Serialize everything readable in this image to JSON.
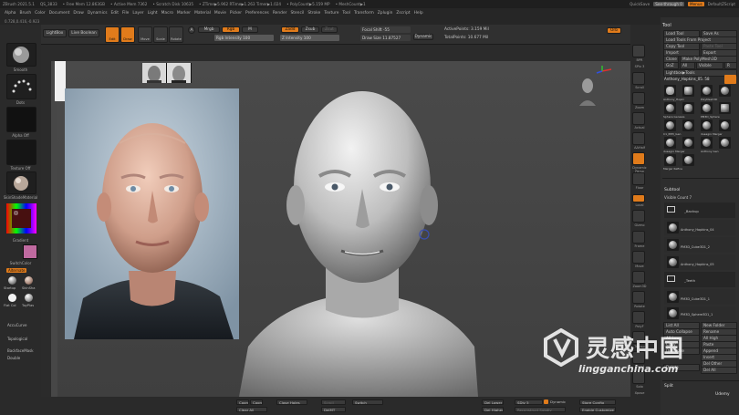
{
  "titlebar": {
    "app": "ZBrush 2021.5.1",
    "project": "QS_3833",
    "free_mem": "• Free Mem 12.863GB",
    "active_mem": "• Active Mem 7362",
    "scratch_disk": "• Scratch Disk 10635",
    "ztime": "• ZTime▶5.962 RTime▶1.263 Timer▶1.024",
    "polycount": "• PolyCount▶5.159 MP",
    "meshcount": "• MeshCount▶1",
    "quicksave": "QuickSave",
    "see_through": "See-through 0",
    "menus": "Menus",
    "default_script": "DefaultZScript"
  },
  "menubar": [
    "Alpha",
    "Brush",
    "Color",
    "Document",
    "Draw",
    "Dynamics",
    "Edit",
    "File",
    "Layer",
    "Light",
    "Macro",
    "Marker",
    "Material",
    "Movie",
    "Picker",
    "Preferences",
    "Render",
    "Stencil",
    "Stroke",
    "Texture",
    "Tool",
    "Transform",
    "Zplugin",
    "Zscript",
    "Help"
  ],
  "topstrip": "0.728,0.416,-0.923",
  "toolbar": {
    "lightbox": "LightBox",
    "live_boolean": "Live Boolean",
    "edit": "Edit",
    "draw": "Draw",
    "move": "Move",
    "scale": "Scale",
    "rotate": "Rotate",
    "a_label": "A",
    "mrgb": "Mrgb",
    "rgb": "Rgb",
    "m": "M",
    "zadd": "Zadd",
    "zsub": "Zsub",
    "zcut": "Zcut",
    "rgb_intensity": "Rgb Intensity 100",
    "z_intensity": "Z Intensity 100",
    "focal_shift": "Focal Shift -55",
    "draw_size": "Draw Size 11.87527",
    "dynamic": "Dynamic",
    "active_points": "ActivePoints: 3.159 Mil",
    "total_points": "TotalPoints: 10.677 Mil",
    "orb": "Orb"
  },
  "leftshelf": {
    "brush": "Smooth",
    "stroke": "Dots",
    "alpha": "Alpha Off",
    "texture": "Texture Off",
    "material": "SkinShadeMaterial",
    "gradient": "Gradient",
    "switch_color": "SwitchColor",
    "alternate": "Alternate",
    "startup_1": "Startup",
    "startup_2": "SkinSha",
    "flat_color": "Flat Col",
    "toy_plastic": "ToyPlas",
    "accucurve": "AccuCurve",
    "topological": "Topological",
    "backface_mask": "BackfaceMask",
    "double": "Double"
  },
  "rightshelf": [
    "BPR",
    "SPix 3",
    "Scroll",
    "Zoom",
    "Actual",
    "AAHalf",
    "Dynamic Persp",
    "Floor",
    "Local",
    "Gizmo",
    "Frame",
    "Move",
    "Zoom3D",
    "Rotate",
    "PolyF",
    "Transp",
    "Ghost",
    "Solo",
    "Xpose"
  ],
  "panel": {
    "title": "Tool",
    "load_tool": "Load Tool",
    "save_as": "Save As",
    "load_from_project": "Load Tools From Project",
    "copy_tool": "Copy Tool",
    "paste_tool": "Paste Tool",
    "import": "Import",
    "export": "Export",
    "clone": "Clone",
    "make_polymesh": "Make PolyMesh3D",
    "goz": "GoZ",
    "all": "All",
    "visible": "Visible",
    "r": "R",
    "lightbox_tools": "Lightbox▶Tools",
    "current_tool": "Anthony_Hopkins_05. 58",
    "thumb_labels": [
      "Anthony_Hopki",
      "Cylinder3D",
      "PolyMesh3D",
      "Sphere3D",
      "Anthony_Hopki",
      "PolyM Cube3D",
      "Anthony_Hopki",
      "SimpleBrush",
      "Sphere Genesis",
      "PM3D_Sphere",
      "EyeBall",
      "C1_PM3_Gen",
      "dusagro Merger",
      "Anthony Gen",
      "dusagro Merger",
      "Anthony Gen",
      "Merger Refine",
      "Merger"
    ],
    "subtool": "Subtool",
    "visible_count": "Visible Count 7",
    "subtools": [
      "_Backup",
      "Anthony_Hopkins_04",
      "PM3D_Cube3D1_2",
      "Anthony_Hopkins_05",
      "_Teeth",
      "PM3D_Cube3D1_1",
      "PM3D_Sphere3D1_1"
    ],
    "list_all": "List All",
    "new_folder": "New Folder",
    "auto_collapse": "Auto Collapse",
    "rename": "Rename",
    "all_low": "All Low",
    "all_high": "All High",
    "copy": "Copy",
    "paste": "Paste",
    "duplicate": "Duplicate",
    "append": "Append",
    "insert": "Insert",
    "delete": "Delete",
    "del_other": "Del Other",
    "del_all": "Del All",
    "split": "Split",
    "udemy": "Udemy"
  },
  "bottombar": {
    "coord1": "Coord",
    "coord2": "CoordZ",
    "close_holes": "Close Holes",
    "scroll_l": "Scroll",
    "switch": "Switch",
    "clear_all": "Clear All",
    "delmt": "DelMT",
    "del_lower": "Del Lower",
    "sdiv": "SDiv 5",
    "dynamic": "Dynamic",
    "store_config": "Store Config",
    "del_higher": "Del Higher",
    "reconstruct": "Reconstruct Subdiv",
    "enable_customize": "Enable Customize"
  },
  "watermark": {
    "brand_cn": "灵感中国",
    "url": "lingganchina.com"
  },
  "colors": {
    "accent": "#e07b1b",
    "panel": "#2e2e2e",
    "viewport": "#474747"
  }
}
